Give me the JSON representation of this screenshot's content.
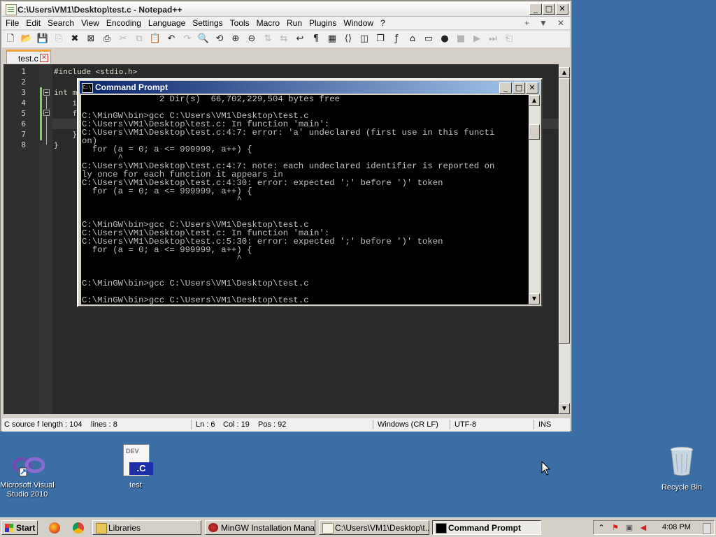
{
  "notepad": {
    "title": "C:\\Users\\VM1\\Desktop\\test.c - Notepad++",
    "menu": [
      "File",
      "Edit",
      "Search",
      "View",
      "Encoding",
      "Language",
      "Settings",
      "Tools",
      "Macro",
      "Run",
      "Plugins",
      "Window",
      "?"
    ],
    "menu_right": [
      "+",
      "▼",
      "✕"
    ],
    "tab_label": "test.c",
    "line_numbers": [
      "1",
      "2",
      "3",
      "4",
      "5",
      "6",
      "7",
      "8"
    ],
    "code_lines": [
      "#include <stdio.h>",
      "",
      "int m",
      "    i",
      "    f",
      "",
      "    }",
      "}"
    ],
    "status": {
      "type": "C source f",
      "length": "length : 104",
      "lines": "lines : 8",
      "ln": "Ln : 6",
      "col": "Col : 19",
      "pos": "Pos : 92",
      "eol": "Windows (CR LF)",
      "encoding": "UTF-8",
      "mode": "INS"
    }
  },
  "cmd": {
    "title": "Command Prompt",
    "icon_text": "C:\\",
    "lines": [
      "               2 Dir(s)  66,702,229,504 bytes free",
      "",
      "C:\\MinGW\\bin>gcc C:\\Users\\VM1\\Desktop\\test.c",
      "C:\\Users\\VM1\\Desktop\\test.c: In function 'main':",
      "C:\\Users\\VM1\\Desktop\\test.c:4:7: error: 'a' undeclared (first use in this functi",
      "on)",
      "  for (a = 0; a <= 999999, a++) {",
      "       ^",
      "C:\\Users\\VM1\\Desktop\\test.c:4:7: note: each undeclared identifier is reported on",
      "ly once for each function it appears in",
      "C:\\Users\\VM1\\Desktop\\test.c:4:30: error: expected ';' before ')' token",
      "  for (a = 0; a <= 999999, a++) {",
      "                              ^",
      "",
      "",
      "C:\\MinGW\\bin>gcc C:\\Users\\VM1\\Desktop\\test.c",
      "C:\\Users\\VM1\\Desktop\\test.c: In function 'main':",
      "C:\\Users\\VM1\\Desktop\\test.c:5:30: error: expected ';' before ')' token",
      "  for (a = 0; a <= 999999, a++) {",
      "                              ^",
      "",
      "",
      "C:\\MinGW\\bin>gcc C:\\Users\\VM1\\Desktop\\test.c",
      "",
      "C:\\MinGW\\bin>gcc C:\\Users\\VM1\\Desktop\\test.c",
      ""
    ],
    "prompt": "C:\\MinGW\\bin>"
  },
  "desktop": {
    "vs_label_1": "Microsoft Visual",
    "vs_label_2": "Studio 2010",
    "file_label": "test",
    "file_badge": ".C",
    "file_logo": "DEV",
    "bin_label": "Recycle Bin"
  },
  "taskbar": {
    "start": "Start",
    "buttons": [
      "Libraries",
      "MinGW Installation Mana...",
      "C:\\Users\\VM1\\Desktop\\t...",
      "Command Prompt"
    ],
    "clock": "4:08 PM"
  },
  "icons": {
    "toolbar": [
      "new-icon",
      "open-icon",
      "save-icon",
      "save-all-icon",
      "close-icon",
      "close-all-icon",
      "print-icon",
      "cut-icon",
      "copy-icon",
      "paste-icon",
      "undo-icon",
      "redo-icon",
      "find-icon",
      "replace-icon",
      "zoom-in-icon",
      "zoom-out-icon",
      "sync-v-icon",
      "sync-h-icon",
      "word-wrap-icon",
      "show-all-chars-icon",
      "indent-guide-icon",
      "udl-icon",
      "doc-map-icon",
      "doc-list-icon",
      "function-list-icon",
      "folder-workspace-icon",
      "monitor-icon",
      "record-macro-icon",
      "stop-macro-icon",
      "play-macro-icon",
      "run-macro-multiple-icon",
      "save-macro-icon"
    ]
  }
}
